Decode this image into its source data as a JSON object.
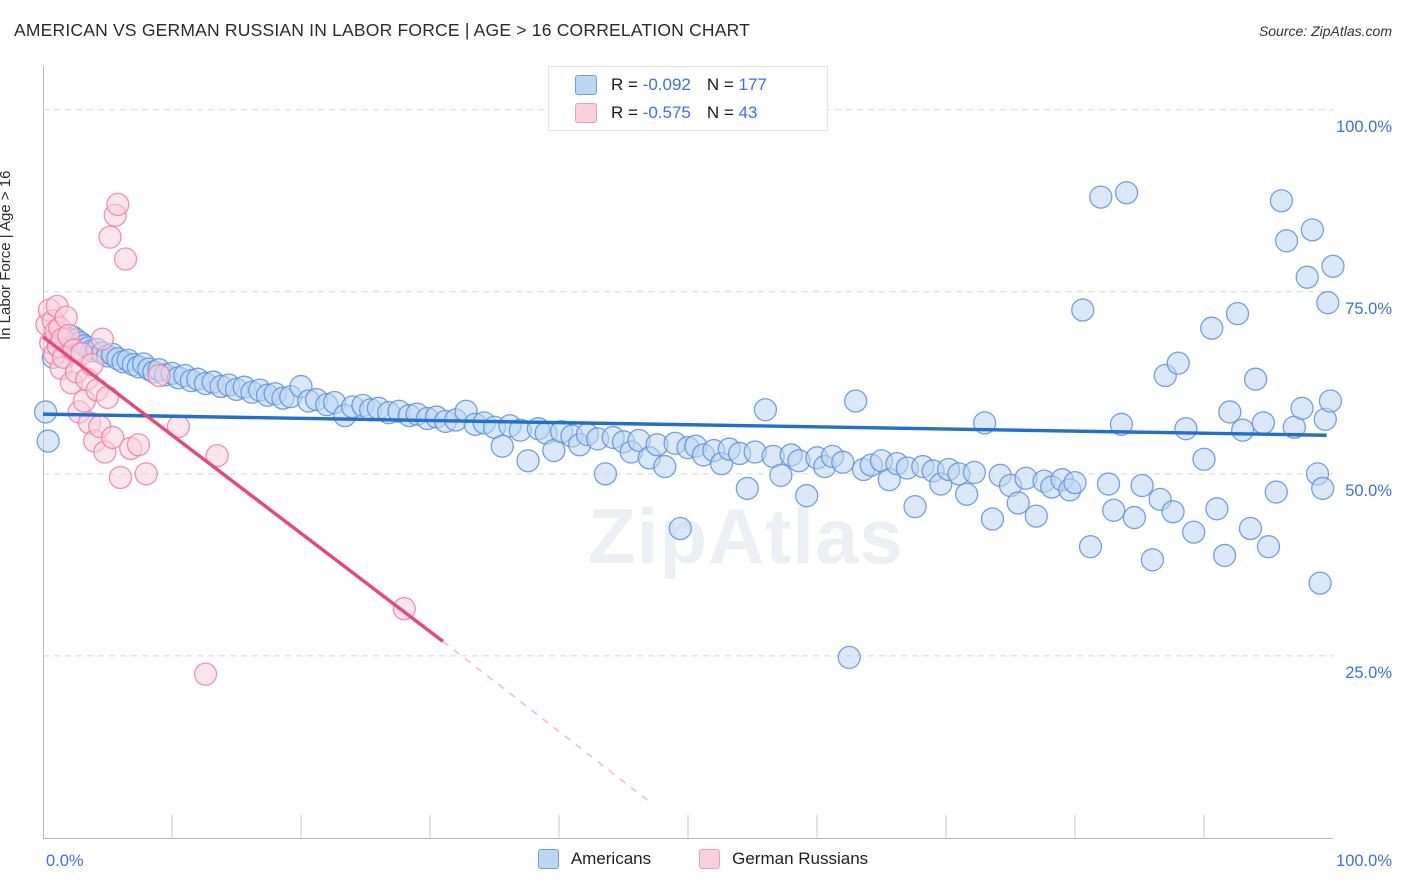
{
  "header": {
    "title": "AMERICAN VS GERMAN RUSSIAN IN LABOR FORCE | AGE > 16 CORRELATION CHART",
    "source": "Source: ZipAtlas.com"
  },
  "watermark": "ZipAtlas",
  "stats": {
    "rows": [
      {
        "series": "Americans",
        "r_label": "R = ",
        "r_value": "-0.092",
        "n_label": "N = ",
        "n_value": "177",
        "color": "#bcd6f5"
      },
      {
        "series": "German Russians",
        "r_label": "R = ",
        "r_value": "-0.575",
        "n_label": "N = ",
        "n_value": "43",
        "color": "#fbd0dd"
      }
    ]
  },
  "legend": {
    "items": [
      {
        "label": "Americans",
        "color": "#bcd6f5"
      },
      {
        "label": "German Russians",
        "color": "#fbd0dd"
      }
    ]
  },
  "axes": {
    "y_title": "In Labor Force | Age > 16",
    "y_ticks": [
      "100.0%",
      "75.0%",
      "50.0%",
      "25.0%"
    ],
    "x_ticks": [
      "0.0%",
      "100.0%"
    ]
  },
  "chart_data": {
    "type": "scatter",
    "title": "AMERICAN VS GERMAN RUSSIAN IN LABOR FORCE | AGE > 16 CORRELATION CHART",
    "xlabel": "",
    "ylabel": "In Labor Force | Age > 16",
    "xlim": [
      0,
      100
    ],
    "ylim": [
      0,
      106
    ],
    "x_tick_values": [
      0,
      100
    ],
    "y_tick_values": [
      25,
      50,
      75,
      100
    ],
    "grid": "horizontal-dashed",
    "legend_position": "bottom-center",
    "series": [
      {
        "name": "Americans",
        "color": "#bcd6f5",
        "edge_color": "#5b92dd",
        "r": -0.092,
        "n": 177,
        "trendline": {
          "x0": 0,
          "y0": 58.2,
          "x1": 99.5,
          "y1": 55.3,
          "color": "#1f6fd4",
          "style": "solid"
        },
        "points": [
          [
            0.2,
            58.5
          ],
          [
            0.4,
            54.5
          ],
          [
            0.8,
            66.0
          ],
          [
            1.2,
            67.5
          ],
          [
            1.6,
            68.2
          ],
          [
            2.0,
            68.6
          ],
          [
            2.3,
            68.8
          ],
          [
            2.6,
            68.4
          ],
          [
            2.9,
            68.0
          ],
          [
            3.2,
            67.6
          ],
          [
            3.5,
            67.3
          ],
          [
            3.8,
            66.9
          ],
          [
            4.2,
            67.1
          ],
          [
            4.6,
            66.6
          ],
          [
            5.0,
            66.2
          ],
          [
            5.4,
            66.4
          ],
          [
            5.8,
            65.8
          ],
          [
            6.2,
            65.4
          ],
          [
            6.6,
            65.6
          ],
          [
            7.0,
            65.0
          ],
          [
            7.4,
            64.7
          ],
          [
            7.8,
            65.1
          ],
          [
            8.2,
            64.4
          ],
          [
            8.6,
            64.0
          ],
          [
            9.0,
            64.3
          ],
          [
            9.5,
            63.6
          ],
          [
            10.0,
            63.8
          ],
          [
            10.5,
            63.2
          ],
          [
            11.0,
            63.5
          ],
          [
            11.5,
            62.8
          ],
          [
            12.0,
            63.0
          ],
          [
            12.6,
            62.4
          ],
          [
            13.2,
            62.6
          ],
          [
            13.8,
            62.0
          ],
          [
            14.4,
            62.2
          ],
          [
            15.0,
            61.6
          ],
          [
            15.6,
            61.9
          ],
          [
            16.2,
            61.2
          ],
          [
            16.8,
            61.5
          ],
          [
            17.4,
            60.8
          ],
          [
            18.0,
            61.0
          ],
          [
            18.6,
            60.4
          ],
          [
            19.2,
            60.6
          ],
          [
            20.0,
            62.0
          ],
          [
            20.6,
            60.0
          ],
          [
            21.2,
            60.2
          ],
          [
            22.0,
            59.5
          ],
          [
            22.6,
            59.8
          ],
          [
            23.4,
            58.0
          ],
          [
            24.0,
            59.2
          ],
          [
            24.8,
            59.4
          ],
          [
            25.4,
            58.8
          ],
          [
            26.0,
            59.0
          ],
          [
            26.8,
            58.4
          ],
          [
            27.6,
            58.6
          ],
          [
            28.4,
            58.0
          ],
          [
            29.0,
            58.2
          ],
          [
            29.8,
            57.6
          ],
          [
            30.5,
            57.8
          ],
          [
            31.2,
            57.2
          ],
          [
            32.0,
            57.4
          ],
          [
            32.8,
            58.6
          ],
          [
            33.5,
            56.8
          ],
          [
            34.2,
            57.0
          ],
          [
            35.0,
            56.4
          ],
          [
            35.6,
            53.8
          ],
          [
            36.2,
            56.6
          ],
          [
            37.0,
            56.0
          ],
          [
            37.6,
            51.8
          ],
          [
            38.4,
            56.2
          ],
          [
            39.0,
            55.6
          ],
          [
            39.6,
            53.2
          ],
          [
            40.2,
            55.8
          ],
          [
            41.0,
            55.2
          ],
          [
            41.6,
            54.0
          ],
          [
            42.2,
            55.4
          ],
          [
            43.0,
            54.8
          ],
          [
            43.6,
            50.0
          ],
          [
            44.2,
            55.0
          ],
          [
            45.0,
            54.4
          ],
          [
            45.6,
            53.0
          ],
          [
            46.2,
            54.6
          ],
          [
            47.0,
            52.2
          ],
          [
            47.6,
            54.0
          ],
          [
            48.2,
            51.0
          ],
          [
            49.0,
            54.2
          ],
          [
            49.4,
            42.5
          ],
          [
            50.0,
            53.6
          ],
          [
            50.6,
            53.8
          ],
          [
            51.2,
            52.6
          ],
          [
            52.0,
            53.2
          ],
          [
            52.6,
            51.4
          ],
          [
            53.2,
            53.4
          ],
          [
            54.0,
            52.8
          ],
          [
            54.6,
            48.0
          ],
          [
            55.2,
            53.0
          ],
          [
            56.0,
            58.8
          ],
          [
            56.6,
            52.4
          ],
          [
            57.2,
            49.8
          ],
          [
            58.0,
            52.6
          ],
          [
            58.6,
            51.8
          ],
          [
            59.2,
            47.0
          ],
          [
            60.0,
            52.2
          ],
          [
            60.6,
            51.0
          ],
          [
            61.2,
            52.4
          ],
          [
            62.0,
            51.6
          ],
          [
            62.5,
            24.8
          ],
          [
            63.0,
            60.0
          ],
          [
            63.6,
            50.6
          ],
          [
            64.2,
            51.2
          ],
          [
            65.0,
            51.8
          ],
          [
            65.6,
            49.2
          ],
          [
            66.2,
            51.4
          ],
          [
            67.0,
            50.8
          ],
          [
            67.6,
            45.5
          ],
          [
            68.2,
            51.0
          ],
          [
            69.0,
            50.4
          ],
          [
            69.6,
            48.6
          ],
          [
            70.2,
            50.6
          ],
          [
            71.0,
            50.0
          ],
          [
            71.6,
            47.2
          ],
          [
            72.2,
            50.2
          ],
          [
            73.0,
            57.0
          ],
          [
            73.6,
            43.8
          ],
          [
            74.2,
            49.8
          ],
          [
            75.0,
            48.4
          ],
          [
            75.6,
            46.0
          ],
          [
            76.2,
            49.4
          ],
          [
            77.0,
            44.2
          ],
          [
            77.6,
            49.0
          ],
          [
            78.2,
            48.2
          ],
          [
            79.0,
            49.2
          ],
          [
            79.6,
            47.8
          ],
          [
            80.0,
            48.8
          ],
          [
            80.6,
            72.5
          ],
          [
            81.2,
            40.0
          ],
          [
            82.0,
            88.0
          ],
          [
            82.6,
            48.6
          ],
          [
            83.0,
            45.0
          ],
          [
            83.6,
            56.8
          ],
          [
            84.0,
            88.6
          ],
          [
            84.6,
            44.0
          ],
          [
            85.2,
            48.4
          ],
          [
            86.0,
            38.2
          ],
          [
            86.6,
            46.5
          ],
          [
            87.0,
            63.5
          ],
          [
            87.6,
            44.8
          ],
          [
            88.0,
            65.2
          ],
          [
            88.6,
            56.2
          ],
          [
            89.2,
            42.0
          ],
          [
            90.0,
            52.0
          ],
          [
            90.6,
            70.0
          ],
          [
            91.0,
            45.2
          ],
          [
            91.6,
            38.8
          ],
          [
            92.0,
            58.5
          ],
          [
            92.6,
            72.0
          ],
          [
            93.0,
            56.0
          ],
          [
            93.6,
            42.5
          ],
          [
            94.0,
            63.0
          ],
          [
            94.6,
            57.0
          ],
          [
            95.0,
            40.0
          ],
          [
            95.6,
            47.5
          ],
          [
            96.0,
            87.5
          ],
          [
            96.4,
            82.0
          ],
          [
            97.0,
            56.4
          ],
          [
            97.6,
            59.0
          ],
          [
            98.0,
            77.0
          ],
          [
            98.4,
            83.5
          ],
          [
            98.8,
            50.0
          ],
          [
            99.0,
            35.0
          ],
          [
            99.2,
            48.0
          ],
          [
            99.4,
            57.5
          ],
          [
            99.6,
            73.5
          ],
          [
            99.8,
            60.0
          ],
          [
            100.0,
            78.5
          ]
        ]
      },
      {
        "name": "German Russians",
        "color": "#fbd0dd",
        "edge_color": "#ef7fa3",
        "r": -0.575,
        "n": 43,
        "trendline": {
          "x0": 0,
          "y0": 68.8,
          "x1": 31.0,
          "y1": 27.0,
          "color": "#e8467c",
          "style": "solid-then-dashed",
          "dash_from_x": 31.0,
          "dash_to_x": 47.0,
          "dash_to_y": 5.0
        },
        "points": [
          [
            0.3,
            70.5
          ],
          [
            0.5,
            72.5
          ],
          [
            0.6,
            68.0
          ],
          [
            0.8,
            71.0
          ],
          [
            0.9,
            66.5
          ],
          [
            1.0,
            69.5
          ],
          [
            1.1,
            73.0
          ],
          [
            1.2,
            67.5
          ],
          [
            1.3,
            70.0
          ],
          [
            1.4,
            64.5
          ],
          [
            1.5,
            68.5
          ],
          [
            1.6,
            66.0
          ],
          [
            1.8,
            71.5
          ],
          [
            2.0,
            69.0
          ],
          [
            2.2,
            62.5
          ],
          [
            2.4,
            67.0
          ],
          [
            2.6,
            64.0
          ],
          [
            2.8,
            58.5
          ],
          [
            3.0,
            66.5
          ],
          [
            3.2,
            60.0
          ],
          [
            3.4,
            63.0
          ],
          [
            3.6,
            57.0
          ],
          [
            3.8,
            65.0
          ],
          [
            4.0,
            54.5
          ],
          [
            4.2,
            61.5
          ],
          [
            4.4,
            56.5
          ],
          [
            4.6,
            68.5
          ],
          [
            4.8,
            53.0
          ],
          [
            5.0,
            60.5
          ],
          [
            5.2,
            82.5
          ],
          [
            5.4,
            55.0
          ],
          [
            5.6,
            85.5
          ],
          [
            5.8,
            87.0
          ],
          [
            6.0,
            49.5
          ],
          [
            6.4,
            79.5
          ],
          [
            6.8,
            53.5
          ],
          [
            7.4,
            54.0
          ],
          [
            8.0,
            50.0
          ],
          [
            9.0,
            63.5
          ],
          [
            10.5,
            56.5
          ],
          [
            12.6,
            22.5
          ],
          [
            13.5,
            52.5
          ],
          [
            28.0,
            31.5
          ]
        ]
      }
    ]
  }
}
